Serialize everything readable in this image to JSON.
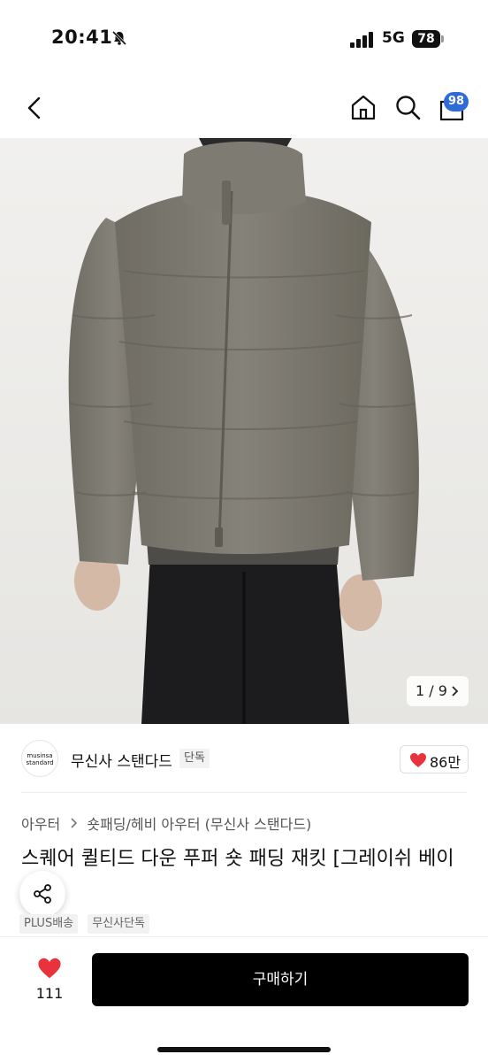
{
  "status_bar": {
    "time": "20:41",
    "network": "5G",
    "battery": "78"
  },
  "header": {
    "icons": [
      "back-icon",
      "home-icon",
      "search-icon",
      "shopping-bag-icon"
    ],
    "cart_badge": "98"
  },
  "gallery": {
    "counter": "1 / 9"
  },
  "brand": {
    "logo_text_line1": "musinsa",
    "logo_text_line2": "standard",
    "name": "무신사 스탠다드",
    "tag": "단독",
    "like_count": "86만"
  },
  "product": {
    "breadcrumb": [
      "아우터",
      "숏패딩/헤비 아우터 (무신사 스탠다드)"
    ],
    "title": "스퀘어 퀼티드 다운 푸퍼 숏 패딩 재킷 [그레이쉬 베이",
    "tags": [
      "PLUS배송",
      "무신사단독"
    ]
  },
  "bottom_bar": {
    "wish_count": "111",
    "buy_label": "구매하기"
  },
  "colors": {
    "badge_blue": "#2f6bd6",
    "heart_red": "#e8323c",
    "jacket": "#7d7a70"
  }
}
